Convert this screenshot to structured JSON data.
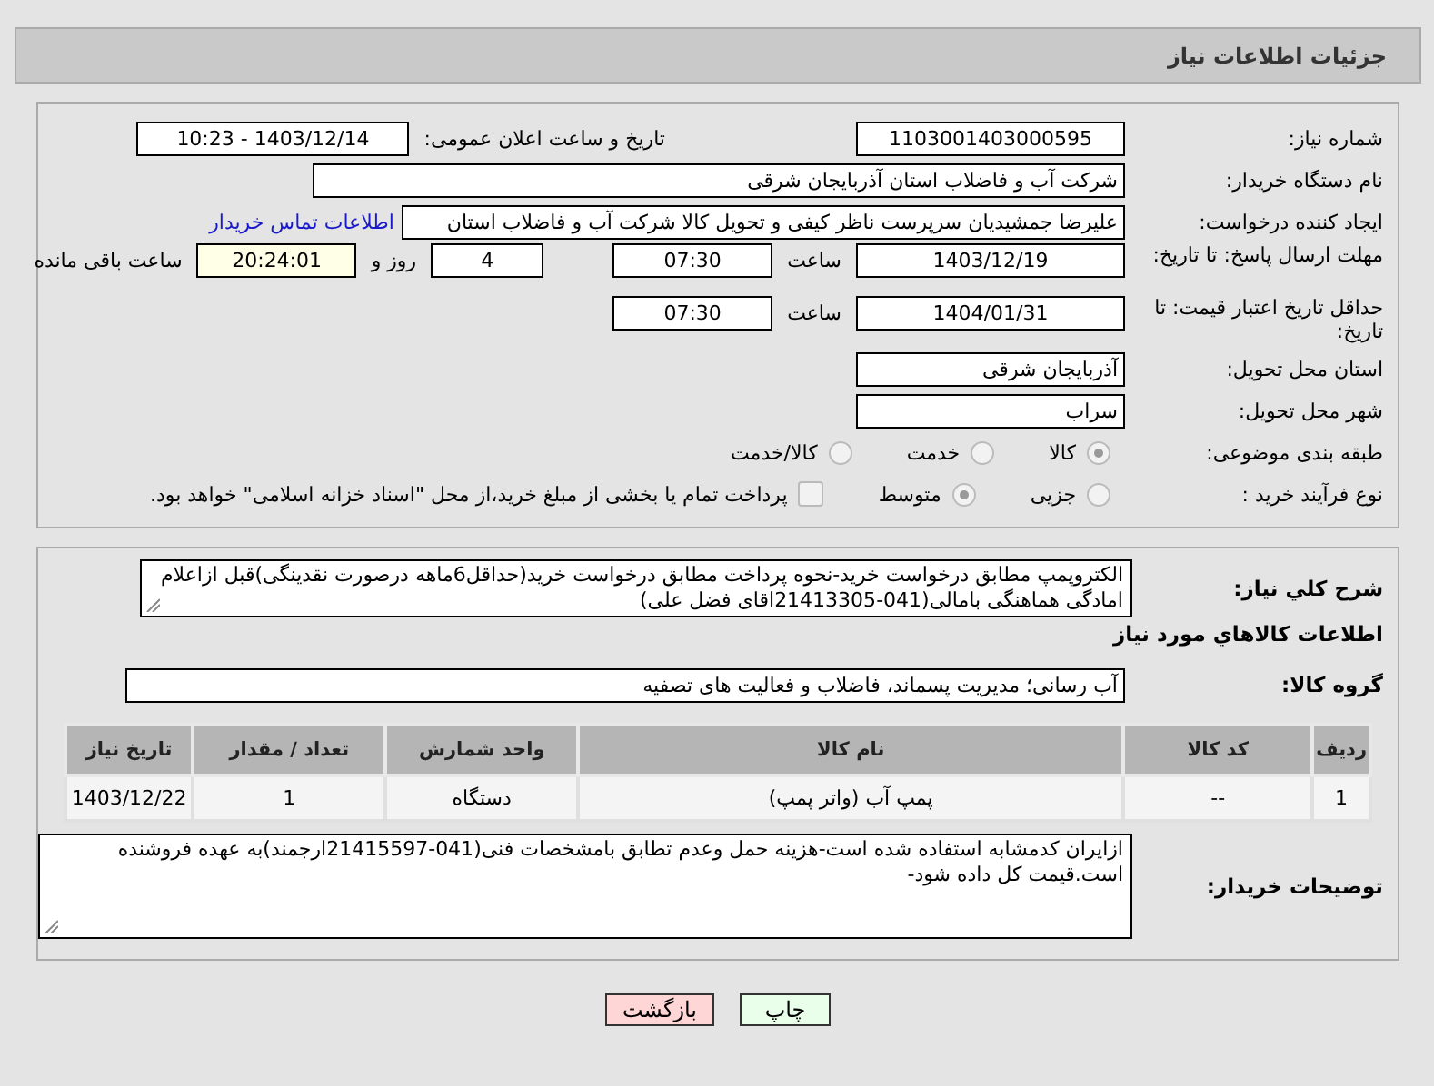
{
  "page_title": "جزئیات اطلاعات نیاز",
  "need_number": {
    "label": "شماره نیاز:",
    "value": "1103001403000595"
  },
  "announce": {
    "label": "تاریخ و ساعت اعلان عمومی:",
    "value": "1403/12/14 - 10:23"
  },
  "buyer": {
    "label": "نام دستگاه خریدار:",
    "value": "شرکت آب و فاضلاب استان آذربایجان شرقی"
  },
  "requester": {
    "label": "ایجاد کننده درخواست:",
    "value": "علیرضا جمشیدیان سرپرست ناظر کیفی و تحویل کالا شرکت آب و فاضلاب استان",
    "link": "اطلاعات تماس خریدار"
  },
  "deadline": {
    "label": "مهلت ارسال پاسخ: تا تاریخ:",
    "date": "1403/12/19",
    "time_label": "ساعت",
    "time": "07:30",
    "days": "4",
    "days_label": "روز و",
    "remaining": "20:24:01",
    "remaining_label": "ساعت باقی مانده"
  },
  "validity": {
    "label": "حداقل تاریخ اعتبار قیمت: تا تاریخ:",
    "date": "1404/01/31",
    "time_label": "ساعت",
    "time": "07:30"
  },
  "province": {
    "label": "استان محل تحویل:",
    "value": "آذربایجان شرقی"
  },
  "city": {
    "label": "شهر محل تحویل:",
    "value": "سراب"
  },
  "category": {
    "label": "طبقه بندی موضوعی:",
    "options": [
      {
        "label": "کالا",
        "selected": true
      },
      {
        "label": "خدمت",
        "selected": false
      },
      {
        "label": "کالا/خدمت",
        "selected": false
      }
    ]
  },
  "process": {
    "label": "نوع فرآیند خرید :",
    "options": [
      {
        "label": "جزیی",
        "selected": false
      },
      {
        "label": "متوسط",
        "selected": true
      }
    ],
    "payment": {
      "checked": false,
      "label": "پرداخت تمام یا بخشی از مبلغ خرید،از محل \"اسناد خزانه اسلامی\" خواهد بود."
    }
  },
  "description": {
    "label": "شرح کلي نياز:",
    "value": "الکتروپمپ مطابق درخواست خرید-نحوه پرداخت مطابق درخواست خرید(حداقل6ماهه درصورت نقدینگی)قبل ازاعلام امادگی هماهنگی بامالی(041-21413305اقای فضل علی)"
  },
  "goods_title": "اطلاعات کالاهاي مورد نياز",
  "group": {
    "label": "گروه کالا:",
    "value": "آب رسانی؛ مدیریت پسماند، فاضلاب و فعالیت های تصفیه"
  },
  "table": {
    "columns": [
      "ردیف",
      "کد کالا",
      "نام کالا",
      "واحد شمارش",
      "تعداد / مقدار",
      "تاریخ نیاز"
    ],
    "rows": [
      [
        "1",
        "--",
        "پمپ آب (واتر پمپ)",
        "دستگاه",
        "1",
        "1403/12/22"
      ]
    ]
  },
  "buyer_notes": {
    "label": "توضیحات خریدار:",
    "value": "ازایران کدمشابه استفاده شده است-هزینه حمل وعدم تطابق بامشخصات فنی(041-21415597ارجمند)به عهده فروشنده است.قیمت کل داده شود-"
  },
  "buttons": [
    {
      "label": "چاپ",
      "kind": "print"
    },
    {
      "label": "بازگشت",
      "kind": "back"
    }
  ]
}
